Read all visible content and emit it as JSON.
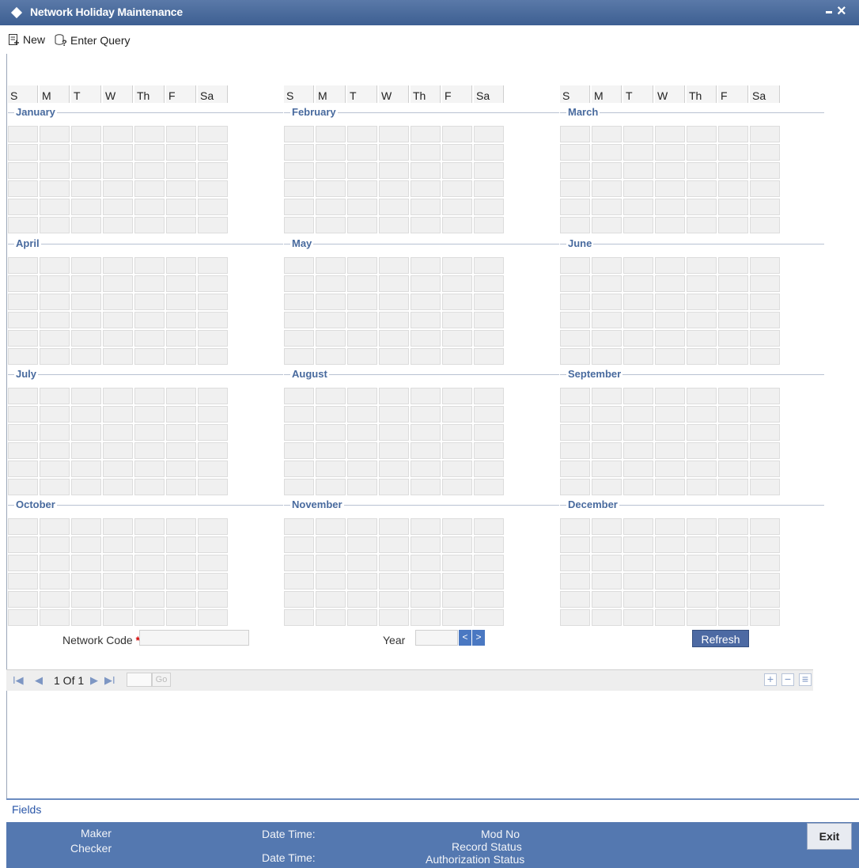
{
  "window": {
    "title": "Network Holiday Maintenance",
    "minimize_label": "minimize",
    "close_label": "close"
  },
  "toolbar": {
    "new_label": "New",
    "enter_query_label": "Enter Query"
  },
  "calendar": {
    "day_headers": [
      "S",
      "M",
      "T",
      "W",
      "Th",
      "F",
      "Sa"
    ],
    "months": [
      "January",
      "February",
      "March",
      "April",
      "May",
      "June",
      "July",
      "August",
      "September",
      "October",
      "November",
      "December"
    ]
  },
  "form": {
    "network_code_label": "Network Code",
    "required_marker": "*",
    "network_code_value": "",
    "year_label": "Year",
    "year_value": "",
    "prev_year_glyph": "<",
    "next_year_glyph": ">",
    "refresh_label": "Refresh"
  },
  "pager": {
    "first_glyph": "I◀",
    "prev_glyph": "◀",
    "page_text": "1 Of 1",
    "next_glyph": "▶",
    "last_glyph": "▶I",
    "page_input_value": "",
    "go_label": "Go",
    "add_glyph": "+",
    "remove_glyph": "−",
    "view_glyph": "≡"
  },
  "footer": {
    "fields_label": "Fields",
    "maker_label": "Maker",
    "checker_label": "Checker",
    "date_time_label_1": "Date Time:",
    "date_time_label_2": "Date Time:",
    "mod_no_label": "Mod No",
    "record_status_label": "Record Status",
    "authorization_status_label": "Authorization Status",
    "exit_label": "Exit"
  }
}
